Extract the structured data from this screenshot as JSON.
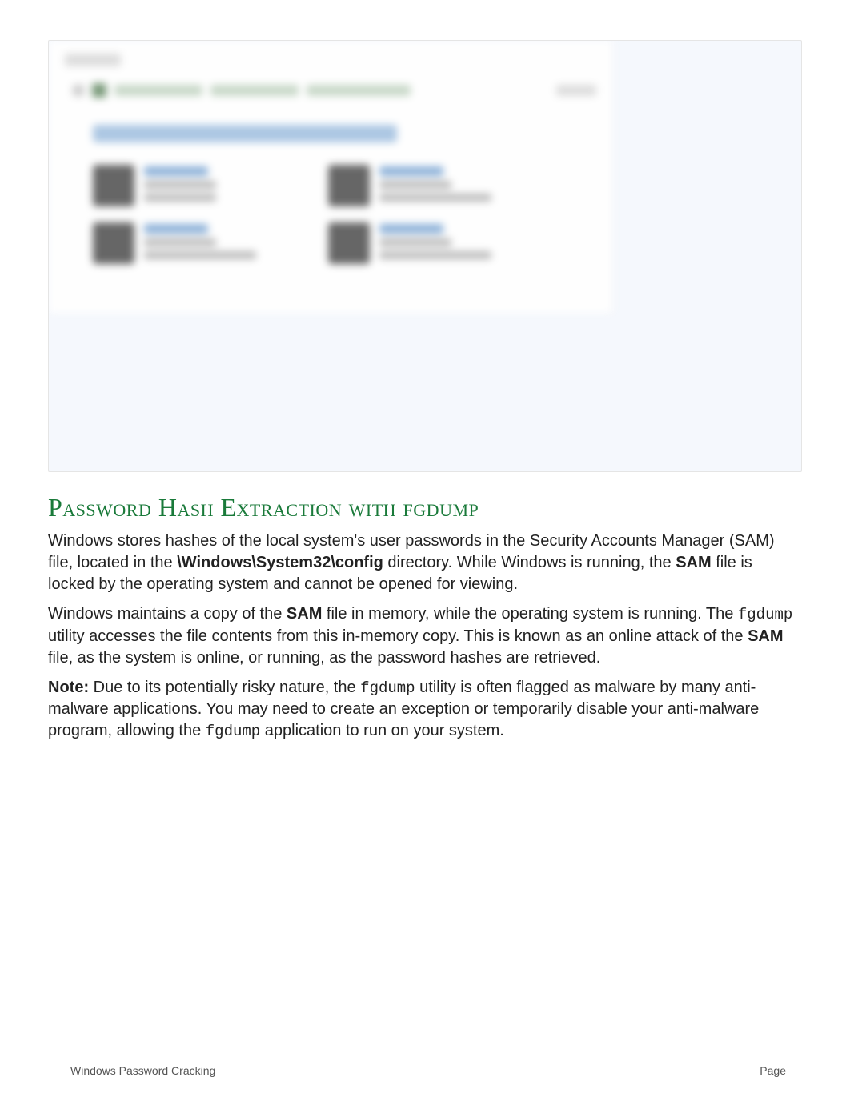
{
  "screenshot": {
    "window_title": "Accounts",
    "breadcrumb": [
      "Control Panel",
      "User Accounts",
      "Manage Accounts"
    ],
    "page_heading": "Choose the user you would like to change",
    "users": [
      {
        "name": "Administrator",
        "lines": [
          "Local Account",
          "Administrator"
        ]
      },
      {
        "name": "TestUser1",
        "lines": [
          "Local Account",
          "Password Protected"
        ]
      },
      {
        "name": "TestUser2",
        "lines": [
          "Local Account",
          "Password Protected"
        ]
      },
      {
        "name": "TestUser3",
        "lines": [
          "Local Account",
          "Password Protected"
        ]
      }
    ]
  },
  "heading": "Password Hash Extraction with fgdump",
  "para1": {
    "t1": "Windows stores hashes of the local system's user passwords in the Security Accounts Manager (SAM) file, located in the ",
    "path": "\\Windows\\System32\\config",
    "t2": " directory. While Windows is running, the ",
    "sam1": "SAM",
    "t3": " file is locked by the operating system and cannot be opened for viewing."
  },
  "para2": {
    "t1": "Windows maintains a copy of the ",
    "sam1": "SAM",
    "t2": " file in memory, while the operating system is running. The ",
    "fg1": "fgdump",
    "t3": " utility accesses the file contents from this in-memory copy. This is known as an online attack of the ",
    "sam2": "SAM",
    "t4": " file, as the system is online, or running, as the password hashes are retrieved."
  },
  "para3": {
    "note": "Note:",
    "t1": " Due to its potentially risky nature, the ",
    "fg1": "fgdump",
    "t2": " utility is often flagged as malware by many anti-malware applications. You may need to create an exception or temporarily disable your anti-malware program, allowing the ",
    "fg2": "fgdump",
    "t3": " application to run on your system."
  },
  "footer": {
    "left": "Windows Password Cracking",
    "right": "Page"
  }
}
